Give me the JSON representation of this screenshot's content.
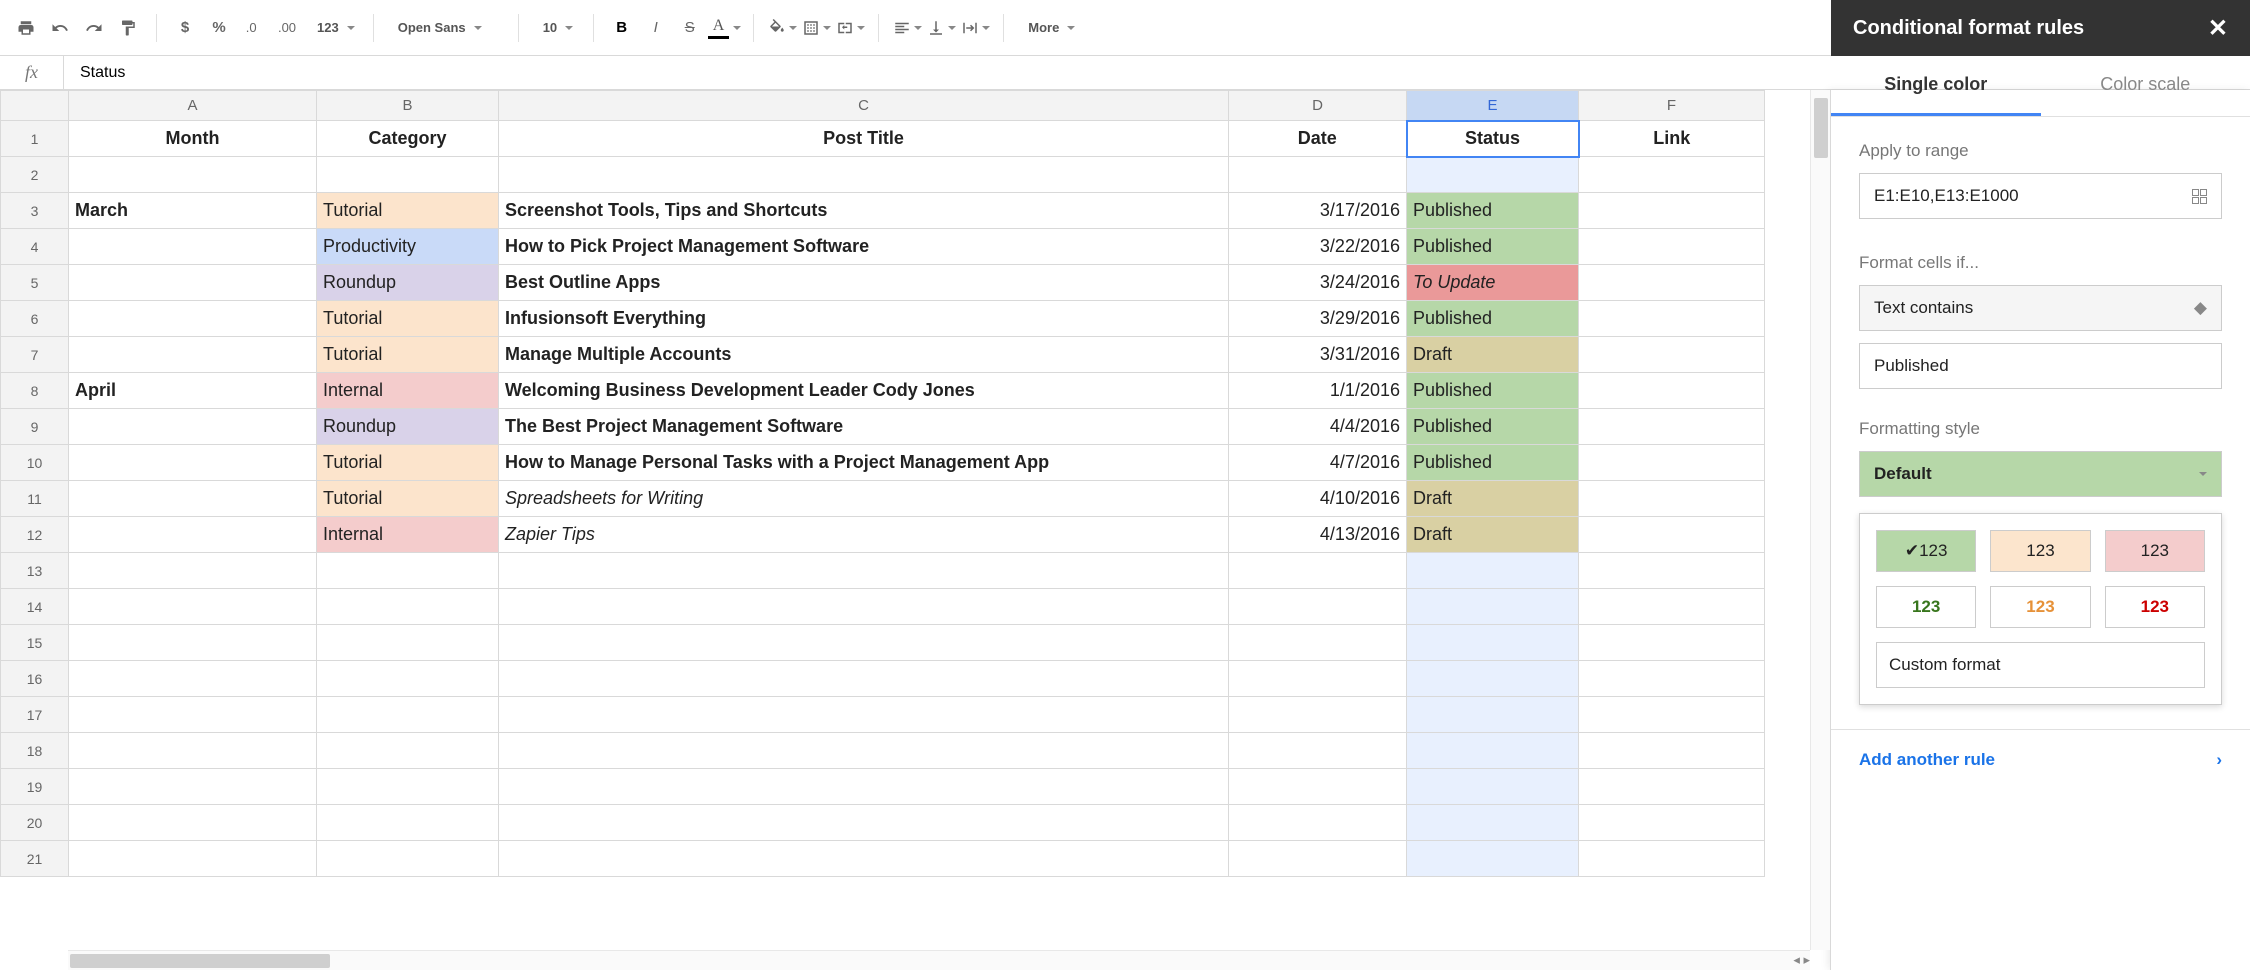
{
  "toolbar": {
    "font": "Open Sans",
    "size": "10",
    "more": "More",
    "fmt123": "123"
  },
  "fx_value": "Status",
  "columns": [
    "",
    "A",
    "B",
    "C",
    "D",
    "E",
    "F"
  ],
  "headers": {
    "A": "Month",
    "B": "Category",
    "C": "Post Title",
    "D": "Date",
    "E": "Status",
    "F": "Link"
  },
  "rows": [
    {
      "n": 2
    },
    {
      "n": 3,
      "A": "March",
      "B": "Tutorial",
      "bcls": "cat-t",
      "C": "Screenshot Tools, Tips and Shortcuts",
      "D": "3/17/2016",
      "E": "Published",
      "ecls": "st-pub"
    },
    {
      "n": 4,
      "B": "Productivity",
      "bcls": "cat-p",
      "C": "How to Pick Project Management Software",
      "D": "3/22/2016",
      "E": "Published",
      "ecls": "st-pub"
    },
    {
      "n": 5,
      "B": "Roundup",
      "bcls": "cat-r",
      "C": "Best Outline Apps",
      "D": "3/24/2016",
      "E": "To Update",
      "ecls": "st-upd"
    },
    {
      "n": 6,
      "B": "Tutorial",
      "bcls": "cat-t",
      "C": "Infusionsoft Everything",
      "D": "3/29/2016",
      "E": "Published",
      "ecls": "st-pub"
    },
    {
      "n": 7,
      "B": "Tutorial",
      "bcls": "cat-t",
      "C": "Manage Multiple Accounts",
      "D": "3/31/2016",
      "E": "Draft",
      "ecls": "st-dft"
    },
    {
      "n": 8,
      "A": "April",
      "B": "Internal",
      "bcls": "cat-i",
      "C": "Welcoming Business Development Leader Cody Jones",
      "D": "1/1/2016",
      "E": "Published",
      "ecls": "st-pub"
    },
    {
      "n": 9,
      "B": "Roundup",
      "bcls": "cat-r",
      "C": "The Best Project Management Software",
      "D": "4/4/2016",
      "E": "Published",
      "ecls": "st-pub"
    },
    {
      "n": 10,
      "B": "Tutorial",
      "bcls": "cat-t",
      "C": "How to Manage Personal Tasks with a Project Management App",
      "D": "4/7/2016",
      "E": "Published",
      "ecls": "st-pub"
    },
    {
      "n": 11,
      "B": "Tutorial",
      "bcls": "cat-t",
      "C": "Spreadsheets for Writing",
      "ccls": "italic-c",
      "D": "4/10/2016",
      "E": "Draft",
      "ecls": "st-dft"
    },
    {
      "n": 12,
      "B": "Internal",
      "bcls": "cat-i",
      "C": "Zapier Tips",
      "ccls": "italic-c",
      "D": "4/13/2016",
      "E": "Draft",
      "ecls": "st-dft"
    },
    {
      "n": 13
    },
    {
      "n": 14
    },
    {
      "n": 15
    },
    {
      "n": 16
    },
    {
      "n": 17
    },
    {
      "n": 18
    },
    {
      "n": 19
    },
    {
      "n": 20
    },
    {
      "n": 21
    }
  ],
  "side": {
    "title": "Conditional format rules",
    "tab1": "Single color",
    "tab2": "Color scale",
    "apply_lbl": "Apply to range",
    "range": "E1:E10,E13:E1000",
    "format_if": "Format cells if...",
    "condition": "Text contains",
    "cond_value": "Published",
    "style_lbl": "Formatting style",
    "style_sel": "Default",
    "sw_sel": "✔123",
    "sw": "123",
    "custom": "Custom format",
    "add_rule": "Add another rule"
  }
}
